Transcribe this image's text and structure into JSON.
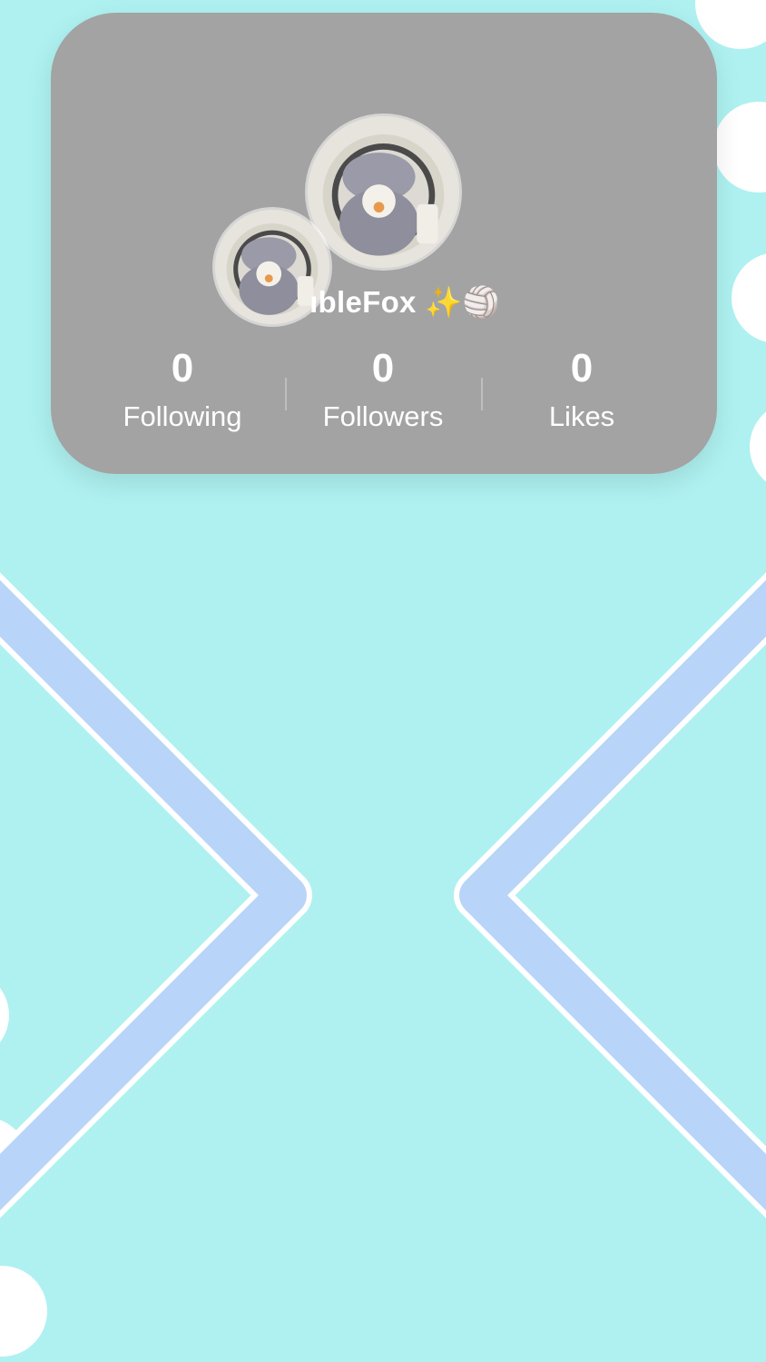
{
  "profile": {
    "username": "ıbleFox ✨🏐",
    "avatar_large": "avatar-photo",
    "avatar_small": "avatar-photo"
  },
  "stats": [
    {
      "value": "0",
      "label": "Following"
    },
    {
      "value": "0",
      "label": "Followers"
    },
    {
      "value": "0",
      "label": "Likes"
    }
  ],
  "colors": {
    "background": "#aef1f0",
    "card": "#a3a3a3",
    "chevron": "#b8d4f8",
    "dots": "#ffffff"
  }
}
